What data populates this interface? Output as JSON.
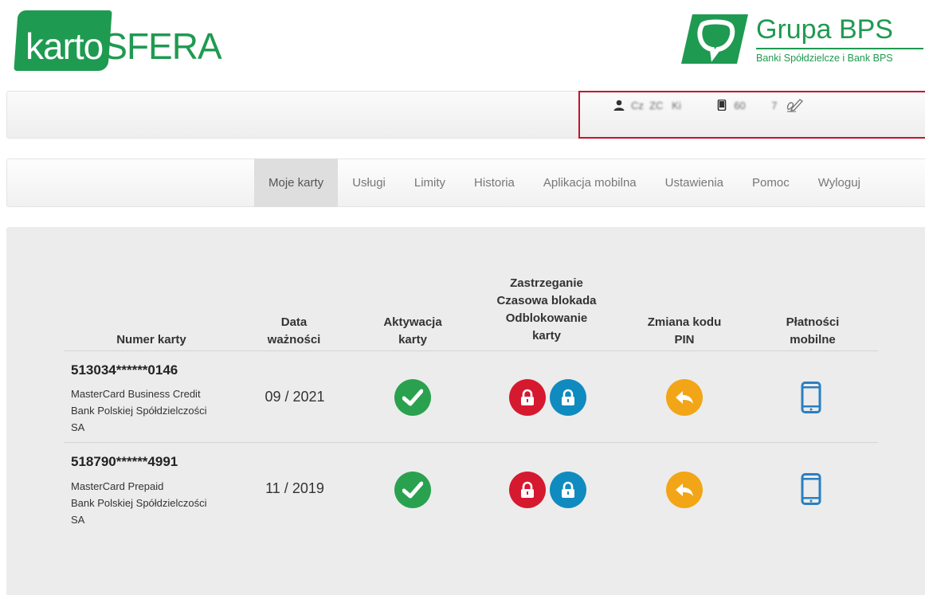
{
  "header": {
    "logo_left": {
      "part1": "karto",
      "part2": "SFERA"
    },
    "logo_right": {
      "name": "Grupa BPS",
      "tagline": "Banki Spółdzielcze i Bank BPS"
    }
  },
  "userbar": {
    "user_name": "Cz  ZC   Ki    ",
    "phone": "60         7",
    "icons": [
      "user-icon",
      "mobile-icon",
      "edit-signature-icon"
    ]
  },
  "nav": {
    "items": [
      {
        "label": "Moje karty",
        "active": true
      },
      {
        "label": "Usługi",
        "active": false
      },
      {
        "label": "Limity",
        "active": false
      },
      {
        "label": "Historia",
        "active": false
      },
      {
        "label": "Aplikacja mobilna",
        "active": false
      },
      {
        "label": "Ustawienia",
        "active": false
      },
      {
        "label": "Pomoc",
        "active": false
      },
      {
        "label": "Wyloguj",
        "active": false
      }
    ]
  },
  "table": {
    "headers": {
      "card_number": "Numer karty",
      "expiry_1": "Data",
      "expiry_2": "ważności",
      "activation_1": "Aktywacja",
      "activation_2": "karty",
      "block_1": "Zastrzeganie",
      "block_2": "Czasowa blokada",
      "block_3": "Odblokowanie",
      "block_4": "karty",
      "pin_1": "Zmiana kodu",
      "pin_2": "PIN",
      "mobile_1": "Płatności",
      "mobile_2": "mobilne"
    },
    "rows": [
      {
        "number": "513034******0146",
        "type": "MasterCard Business Credit",
        "bank_1": "Bank Polskiej Spółdzielczości",
        "bank_2": "SA",
        "expiry": "09 / 2021"
      },
      {
        "number": "518790******4991",
        "type": "MasterCard Prepaid",
        "bank_1": "Bank Polskiej Spółdzielczości",
        "bank_2": "SA",
        "expiry": "11 / 2019"
      }
    ]
  },
  "colors": {
    "brand_green": "#1f9a51",
    "activate_green": "#2aa14f",
    "block_red": "#d5192f",
    "unblock_blue": "#0f8bbf",
    "pin_orange": "#f2a516",
    "phone_blue": "#2a7fc1",
    "highlight_red": "#c8102e"
  }
}
